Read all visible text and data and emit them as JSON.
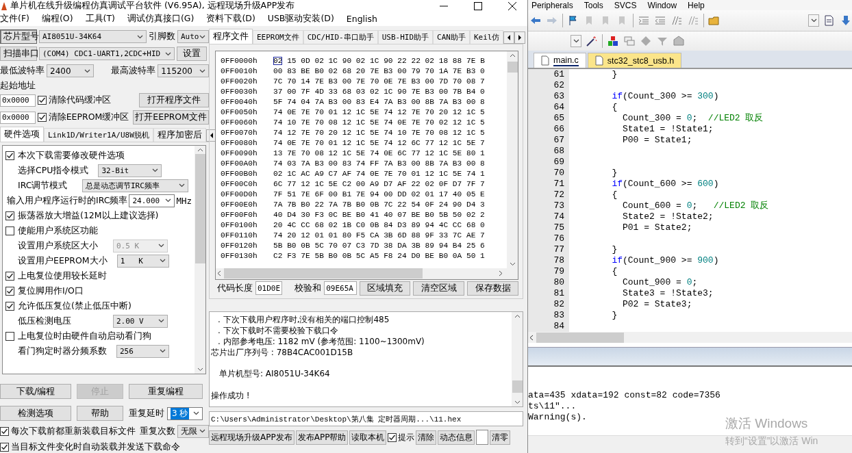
{
  "left_window": {
    "title": "单片机在线升级编程仿真调试平台软件 (V6.95A), 远程现场升级APP发布",
    "menu": [
      "文件(F)",
      "编程(O)",
      "工具(T)",
      "调试仿真接口(G)",
      "资料下载(D)",
      "USB驱动安装(D)",
      "English"
    ],
    "chip": {
      "button": "芯片型号",
      "model": "AI8051U-34K64",
      "pins_label": "引脚数",
      "pins": "Auto"
    },
    "port": {
      "button": "扫描串口",
      "value": "(COM4) CDC1-UART1,2CDC+HID",
      "settings": "设置"
    },
    "baud": {
      "min_label": "最低波特率",
      "min": "2400",
      "max_label": "最高波特率",
      "max": "115200"
    },
    "start_address": {
      "label": "起始地址",
      "code": "0x0000",
      "eeprom": "0x0000"
    },
    "clear_code": {
      "label": "清除代码缓冲区",
      "checked": true
    },
    "clear_eeprom": {
      "label": "清除EEPROM缓冲区",
      "checked": true
    },
    "open_program": "打开程序文件",
    "open_eeprom": "打开EEPROM文件",
    "option_tabs": [
      {
        "label": "硬件选项",
        "selected": true
      },
      {
        "label": "Link1D/Writer1A/U8W脱机",
        "selected": false
      },
      {
        "label": "程序加密后",
        "selected": false
      }
    ],
    "options": [
      {
        "kind": "checkbox",
        "label": "本次下载需要修改硬件选项",
        "checked": true
      },
      {
        "kind": "select",
        "label": "选择CPU指令模式",
        "value": "32-Bit",
        "disabled": false
      },
      {
        "kind": "select",
        "label": "IRC调节模式",
        "value": "总是动态调节IRC频率",
        "disabled": false
      },
      {
        "kind": "combo",
        "label": "输入用户程序运行时的IRC频率",
        "value": "24.000",
        "unit": "MHz"
      },
      {
        "kind": "checkbox",
        "label": "振荡器放大增益(12M以上建议选择)",
        "checked": true
      },
      {
        "kind": "checkbox",
        "label": "使能用户系统区功能",
        "checked": false
      },
      {
        "kind": "select",
        "label": "设置用户系统区大小",
        "value": "0.5 K",
        "disabled": true
      },
      {
        "kind": "select",
        "label": "设置用户EEPROM大小",
        "value": "1   K",
        "disabled": false
      },
      {
        "kind": "checkbox",
        "label": "上电复位使用较长延时",
        "checked": true
      },
      {
        "kind": "checkbox",
        "label": "复位脚用作I/O口",
        "checked": true
      },
      {
        "kind": "checkbox",
        "label": "允许低压复位(禁止低压中断)",
        "checked": true
      },
      {
        "kind": "select",
        "label": "低压检测电压",
        "value": "2.00 V",
        "disabled": false
      },
      {
        "kind": "checkbox",
        "label": "上电复位时由硬件自动启动看门狗",
        "checked": false
      },
      {
        "kind": "select",
        "label": "看门狗定时器分频系数",
        "value": "256",
        "disabled": false
      }
    ],
    "action_buttons": [
      {
        "label": "下载/编程",
        "disabled": false
      },
      {
        "label": "停止",
        "disabled": true
      },
      {
        "label": "重复编程",
        "disabled": false
      }
    ],
    "check_buttons": [
      {
        "label": "检测选项",
        "disabled": false
      },
      {
        "label": "帮助",
        "disabled": false
      }
    ],
    "repeat_delay": {
      "label": "重复延时",
      "value": "3 秒"
    },
    "repeat_count": {
      "label": "重复次数",
      "value": "无限"
    },
    "reload_before": {
      "label": "每次下载前都重新装载目标文件",
      "checked": true
    },
    "auto_reload": {
      "label": "当目标文件变化时自动装载并发送下载命令",
      "checked": true
    },
    "main_tabs": [
      {
        "label": "程序文件",
        "selected": true
      },
      {
        "label": "EEPROM文件",
        "selected": false
      },
      {
        "label": "CDC/HID-串口助手",
        "selected": false
      },
      {
        "label": "USB-HID助手",
        "selected": false
      },
      {
        "label": "CAN助手",
        "selected": false
      },
      {
        "label": "Keil仿",
        "selected": false
      }
    ],
    "hex_rows": [
      {
        "address": "0FF0000h",
        "cursor_byte": "02",
        "bytes": "15 0D 02 1C 90 02 1C 90 22 22 02 18 88 7E B"
      },
      {
        "address": "0FF0010h",
        "bytes": "00 83 BE B0 02 68 20 7E B3 00 79 70 1A 7E B3 0"
      },
      {
        "address": "0FF0020h",
        "bytes": "7C 70 14 7E B3 00 7E 70 0E 7E B3 00 7D 70 08 7"
      },
      {
        "address": "0FF0030h",
        "bytes": "37 00 7F 4D 33 68 03 02 1C 90 7E B3 00 7B B4 0"
      },
      {
        "address": "0FF0040h",
        "bytes": "5F 74 04 7A B3 00 83 E4 7A B3 00 8B 7A B3 00 8"
      },
      {
        "address": "0FF0050h",
        "bytes": "74 0E 7E 70 01 12 1C 5E 74 12 7E 70 20 12 1C 5"
      },
      {
        "address": "0FF0060h",
        "bytes": "74 10 7E 70 08 12 1C 5E 74 0E 7E 70 02 12 1C 5"
      },
      {
        "address": "0FF0070h",
        "bytes": "74 12 7E 70 20 12 1C 5E 74 10 7E 70 08 12 1C 5"
      },
      {
        "address": "0FF0080h",
        "bytes": "74 0E 7E 70 01 12 1C 5E 74 12 6C 77 12 1C 5E 7"
      },
      {
        "address": "0FF0090h",
        "bytes": "13 7E 70 08 12 1C 5E 74 0E 6C 77 12 1C 5E 80 1"
      },
      {
        "address": "0FF00A0h",
        "bytes": "74 03 7A B3 00 83 74 FF 7A B3 00 8B 7A B3 00 8"
      },
      {
        "address": "0FF00B0h",
        "bytes": "02 1C AC A9 C7 AF 74 0E 7E 70 01 12 1C 5E 74 1"
      },
      {
        "address": "0FF00C0h",
        "bytes": "6C 77 12 1C 5E C2 00 A9 D7 AF 22 02 0F D7 7F 7"
      },
      {
        "address": "0FF00D0h",
        "bytes": "7F 51 7E 6F 00 B1 7E 94 00 DD 02 01 17 40 05 E"
      },
      {
        "address": "0FF00E0h",
        "bytes": "7A 7B B0 22 7A 7B B0 0B 7C 22 54 0F 24 90 D4 3"
      },
      {
        "address": "0FF00F0h",
        "bytes": "40 D4 30 F3 0C BE B0 41 40 07 BE B0 5B 50 02 2"
      },
      {
        "address": "0FF0100h",
        "bytes": "20 4C CC 68 02 1B C0 0B 84 D3 89 94 4C CC 68 0"
      },
      {
        "address": "0FF0110h",
        "bytes": "74 20 12 01 01 80 F5 CA 3B 6D 88 9F 33 7C AE 7"
      },
      {
        "address": "0FF0120h",
        "bytes": "5B B0 0B 5C 70 07 C3 7D 38 DA 3B 89 94 B4 25 6"
      },
      {
        "address": "0FF0130h",
        "bytes": "C2 F3 7E 5B B0 0B 5C A5 F8 24 D0 BE B0 0A 50 1"
      }
    ],
    "code_length": {
      "label": "代码长度",
      "value": "01D0E"
    },
    "checksum": {
      "label": "校验和",
      "value": "09E65A"
    },
    "hex_buttons": [
      "区域填充",
      "清空区域",
      "保存数据"
    ],
    "log": [
      {
        "kind": "bullet",
        "text": ". 下次下载用户程序时,没有相关的端口控制485",
        "spaced": false
      },
      {
        "kind": "bullet",
        "text": ". 下次下载时不需要校验下载口令",
        "spaced": false
      },
      {
        "kind": "bullet",
        "text": ". 内部参考电压: 1182 mV (参考范围: 1100~1300mV)",
        "spaced": false
      },
      {
        "kind": "plain",
        "text": "芯片出厂序列号 : 78B4CAC001D15B",
        "spaced": false
      },
      {
        "kind": "indented",
        "text": "单片机型号: AI8051U-34K64",
        "spaced": true
      },
      {
        "kind": "plain",
        "text": "操作成功 !",
        "spaced": true
      }
    ],
    "file_path": "C:\\Users\\Administrator\\Desktop\\第八集 定时器周期...\\11.hex",
    "bottom_controls": [
      {
        "kind": "button",
        "label": "远程现场升级APP发布"
      },
      {
        "kind": "button",
        "label": "发布APP帮助"
      },
      {
        "kind": "button",
        "label": "读取本机"
      },
      {
        "kind": "checkbox",
        "label": "提示",
        "checked": true
      },
      {
        "kind": "button",
        "label": "清除"
      },
      {
        "kind": "button",
        "label": "动态信息"
      },
      {
        "kind": "field"
      },
      {
        "kind": "button",
        "label": "清零"
      }
    ]
  },
  "ide": {
    "menu": [
      "Peripherals",
      "Tools",
      "SVCS",
      "Window",
      "Help"
    ],
    "file_tabs": [
      {
        "label": "main.c",
        "selected": true
      },
      {
        "label": "stc32_stc8_usb.h",
        "selected": false
      }
    ],
    "code_lines": [
      {
        "number": "61",
        "tokens": [
          {
            "kind": "plain",
            "text": "        }"
          }
        ]
      },
      {
        "number": "62"
      },
      {
        "number": "63",
        "tokens": [
          {
            "kind": "keyword",
            "text": "        if"
          },
          {
            "kind": "plain",
            "text": "(Count_300 >= "
          },
          {
            "kind": "number",
            "text": "300"
          },
          {
            "kind": "plain",
            "text": ")"
          }
        ]
      },
      {
        "number": "64",
        "tokens": [
          {
            "kind": "plain",
            "text": "        {"
          }
        ]
      },
      {
        "number": "65",
        "tokens": [
          {
            "kind": "plain",
            "text": "          Count_300 = "
          },
          {
            "kind": "number",
            "text": "0"
          },
          {
            "kind": "plain",
            "text": ";  "
          },
          {
            "kind": "comment",
            "text": "//LED2 取反"
          }
        ]
      },
      {
        "number": "66",
        "tokens": [
          {
            "kind": "plain",
            "text": "          State1 = !State1;"
          }
        ]
      },
      {
        "number": "67",
        "tokens": [
          {
            "kind": "plain",
            "text": "          P00 = State1;"
          }
        ]
      },
      {
        "number": "68"
      },
      {
        "number": "69"
      },
      {
        "number": "70",
        "tokens": [
          {
            "kind": "plain",
            "text": "        }"
          }
        ]
      },
      {
        "number": "71",
        "tokens": [
          {
            "kind": "keyword",
            "text": "        if"
          },
          {
            "kind": "plain",
            "text": "(Count_600 >= "
          },
          {
            "kind": "number",
            "text": "600"
          },
          {
            "kind": "plain",
            "text": ")"
          }
        ]
      },
      {
        "number": "72",
        "tokens": [
          {
            "kind": "plain",
            "text": "        {"
          }
        ]
      },
      {
        "number": "73",
        "tokens": [
          {
            "kind": "plain",
            "text": "          Count_600 = "
          },
          {
            "kind": "number",
            "text": "0"
          },
          {
            "kind": "plain",
            "text": ";   "
          },
          {
            "kind": "comment",
            "text": "//LED2 取反"
          }
        ]
      },
      {
        "number": "74",
        "tokens": [
          {
            "kind": "plain",
            "text": "          State2 = !State2;"
          }
        ]
      },
      {
        "number": "75",
        "tokens": [
          {
            "kind": "plain",
            "text": "          P01 = State2;"
          }
        ]
      },
      {
        "number": "76"
      },
      {
        "number": "77",
        "tokens": [
          {
            "kind": "plain",
            "text": "        }"
          }
        ]
      },
      {
        "number": "78",
        "tokens": [
          {
            "kind": "keyword",
            "text": "        if"
          },
          {
            "kind": "plain",
            "text": "(Count_900 >= "
          },
          {
            "kind": "number",
            "text": "900"
          },
          {
            "kind": "plain",
            "text": ")"
          }
        ]
      },
      {
        "number": "79",
        "tokens": [
          {
            "kind": "plain",
            "text": "        {"
          }
        ]
      },
      {
        "number": "80",
        "tokens": [
          {
            "kind": "plain",
            "text": "          Count_900 = "
          },
          {
            "kind": "number",
            "text": "0"
          },
          {
            "kind": "plain",
            "text": ";"
          }
        ]
      },
      {
        "number": "81",
        "tokens": [
          {
            "kind": "plain",
            "text": "          State3 = !State3;"
          }
        ]
      },
      {
        "number": "82",
        "tokens": [
          {
            "kind": "plain",
            "text": "          P02 = State3;"
          }
        ]
      },
      {
        "number": "83",
        "tokens": [
          {
            "kind": "plain",
            "text": "        }"
          }
        ]
      },
      {
        "number": "84"
      }
    ],
    "build_output": [
      "ata=435 xdata=192 const=82 code=7356",
      "ts\\11\"...",
      "Warning(s)."
    ],
    "activation_notice": {
      "title": "激活 Windows",
      "hint": "转到“设置”以激活 Win"
    }
  }
}
